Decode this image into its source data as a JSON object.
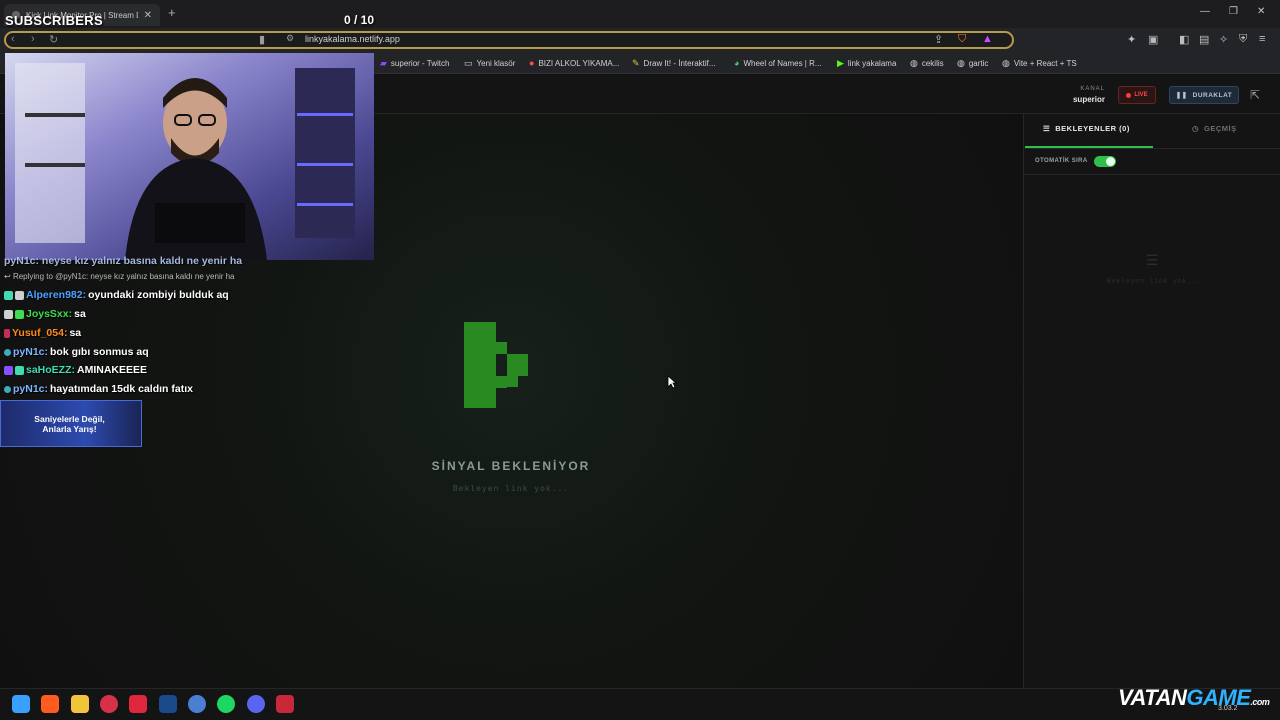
{
  "browser": {
    "tab_title": "Kick Link Monitor Pro | Stream D",
    "url": "linkyakalama.netlify.app",
    "bookmarks": [
      "superior - Twitch",
      "Yeni klasör",
      "BIZI ALKOL YIKAMA...",
      "Draw It! - İnteraktif...",
      "Wheel of Names | R...",
      "link yakalama",
      "cekilis",
      "gartic",
      "Vite + React + TS"
    ]
  },
  "header": {
    "channel_label": "KANAL",
    "channel_value": "superior",
    "live_label": "LIVE",
    "pause_label": "DURAKLAT"
  },
  "main": {
    "status_title": "SİNYAL BEKLENİYOR",
    "status_subtitle": "Bekleyen link yok..."
  },
  "right_panel": {
    "tab_waiting": "BEKLEYENLER (0)",
    "tab_history": "GEÇMİŞ",
    "auto_queue_label": "OTOMATİK SIRA",
    "auto_queue_on": true,
    "empty_text": "Bekleyen link yok..."
  },
  "overlay": {
    "subscribers_label": "SUBSCRIBERS",
    "counter": "0  / 10",
    "reply_text": "Replying to @pyN1c: neyse kız yalnız basına kaldı ne yenir ha",
    "chat": [
      {
        "user": "Alperen982:",
        "msg": "oyundaki zombiyi bulduk aq",
        "color": "#4aa3ff"
      },
      {
        "user": "JoysSxx:",
        "msg": "sa",
        "color": "#3fdc4f"
      },
      {
        "user": "Yusuf_054:",
        "msg": "sa",
        "color": "#ff8a1f"
      },
      {
        "user": "pyN1c:",
        "msg": "bok gıbı sonmus aq",
        "color": "#7fb6ff"
      },
      {
        "user": "saHoEZZ:",
        "msg": "AMINAKEEEE",
        "color": "#3fdcb0"
      },
      {
        "user": "pyN1c:",
        "msg": "hayatımdan 15dk caldın fatıx",
        "color": "#7fb6ff"
      }
    ],
    "partial_line": "pyN1c: neyse kız yalnız basına kaldı ne yenir ha",
    "promo_text": "Saniyelerle Değil, Anlarla Yarış!"
  },
  "watermark": {
    "brand_white": "VATAN",
    "brand_cyan": "GAME",
    "suffix": ".com",
    "date": "3.03.2"
  },
  "colors": {
    "accent_green": "#2fbf4f",
    "live_red": "#ff3b3b"
  }
}
